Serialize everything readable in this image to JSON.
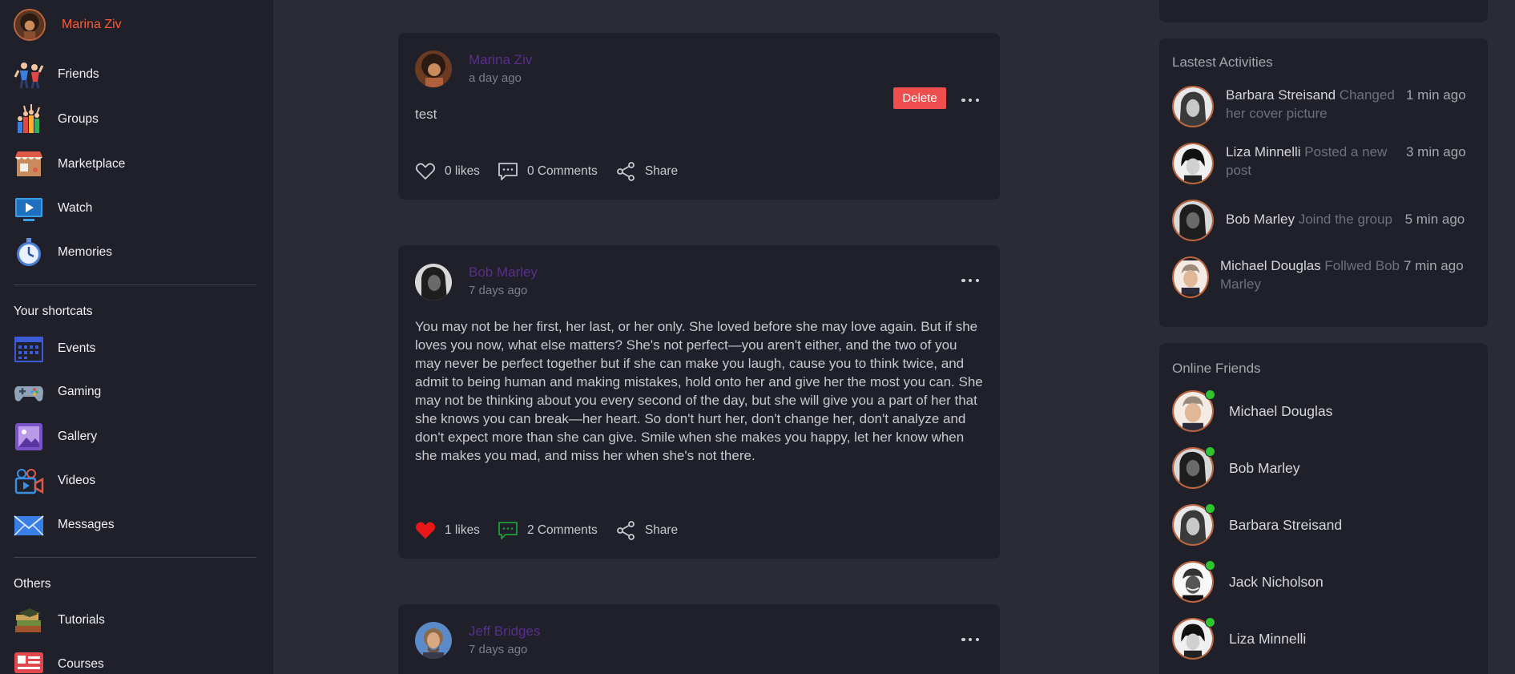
{
  "sidebar": {
    "profile": {
      "name": "Marina Ziv"
    },
    "menu": [
      {
        "label": "Friends",
        "icon": "friends-icon"
      },
      {
        "label": "Groups",
        "icon": "groups-icon"
      },
      {
        "label": "Marketplace",
        "icon": "marketplace-icon"
      },
      {
        "label": "Watch",
        "icon": "watch-icon"
      },
      {
        "label": "Memories",
        "icon": "memories-icon"
      }
    ],
    "shortcuts_title": "Your shortcats",
    "shortcuts": [
      {
        "label": "Events",
        "icon": "events-icon"
      },
      {
        "label": "Gaming",
        "icon": "gaming-icon"
      },
      {
        "label": "Gallery",
        "icon": "gallery-icon"
      },
      {
        "label": "Videos",
        "icon": "videos-icon"
      },
      {
        "label": "Messages",
        "icon": "messages-icon"
      }
    ],
    "others_title": "Others",
    "others": [
      {
        "label": "Tutorials",
        "icon": "tutorials-icon"
      },
      {
        "label": "Courses",
        "icon": "courses-icon"
      }
    ]
  },
  "feed": {
    "posts": [
      {
        "author": "Marina Ziv",
        "time": "a day ago",
        "delete_label": "Delete",
        "text": "test",
        "likes": "0 likes",
        "comments": "0 Comments",
        "share": "Share",
        "liked": false
      },
      {
        "author": "Bob Marley",
        "time": "7 days ago",
        "text": "You may not be her first, her last, or her only. She loved before she may love again. But if she loves you now, what else matters? She's not perfect—you aren't either, and the two of you may never be perfect together but if she can make you laugh, cause you to think twice, and admit to being human and making mistakes, hold onto her and give her the most you can. She may not be thinking about you every second of the day, but she will give you a part of her that she knows you can break—her heart. So don't hurt her, don't change her, don't analyze and don't expect more than she can give. Smile when she makes you happy, let her know when she makes you mad, and miss her when she's not there.",
        "likes": "1 likes",
        "comments": "2 Comments",
        "share": "Share",
        "liked": true
      },
      {
        "author": "Jeff Bridges",
        "time": "7 days ago"
      }
    ]
  },
  "activities": {
    "title": "Lastest Activities",
    "items": [
      {
        "name": "Barbara Streisand",
        "action": "Changed her cover picture",
        "time": "1 min ago"
      },
      {
        "name": "Liza Minnelli",
        "action": "Posted a new post",
        "time": "3 min ago"
      },
      {
        "name": "Bob Marley",
        "action": "Joind the group",
        "time": "5 min ago"
      },
      {
        "name": "Michael Douglas",
        "action": "Follwed Bob Marley",
        "time": "7 min ago"
      }
    ]
  },
  "online_friends": {
    "title": "Online Friends",
    "items": [
      {
        "name": "Michael Douglas"
      },
      {
        "name": "Bob Marley"
      },
      {
        "name": "Barbara Streisand"
      },
      {
        "name": "Jack Nicholson"
      },
      {
        "name": "Liza Minnelli"
      }
    ]
  },
  "colors": {
    "background": "#2a2b36",
    "panel": "#1f2029",
    "profile_name": "#ff5a36",
    "post_author": "#5b2d8e",
    "delete": "#ef4e4e",
    "like_active": "#e81818",
    "comment_active": "#1f9d3a",
    "online": "#2fc52f"
  }
}
